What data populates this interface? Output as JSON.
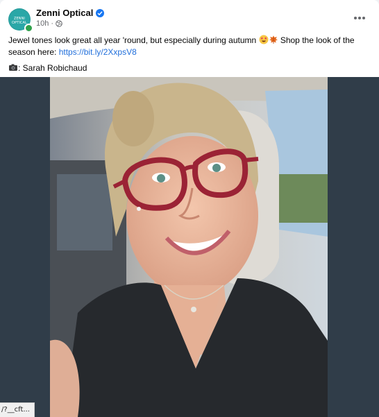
{
  "post": {
    "page_name": "Zenni Optical",
    "avatar_text": "ZENNI OPTICAL",
    "timestamp": "10h",
    "separator": "·",
    "visibility_icon": "globe-icon",
    "verified_icon": "verified-badge-icon",
    "more_icon": "more-options-icon",
    "caption": {
      "text_before_emoji": "Jewel tones look great all year 'round, but especially during autumn ",
      "emojis": [
        "star-struck-emoji",
        "autumn-leaf-emoji"
      ],
      "text_after_emoji": " Shop the look of the season here: ",
      "link": "https://bit.ly/2XxpsV8"
    },
    "credit": {
      "icon": "camera-icon",
      "text": ": Sarah Robichaud"
    }
  },
  "media": {
    "photo_alt": "woman wearing red glasses in car",
    "photo_icon": "post-photo"
  },
  "status_bar": {
    "url": "/?__cft..."
  },
  "colors": {
    "link": "#216fdb",
    "verified": "#1877f2",
    "online": "#31a24c",
    "media_bg": "#303d49",
    "avatar_bg": "#2aa7a7",
    "glasses": "#9b2335"
  }
}
